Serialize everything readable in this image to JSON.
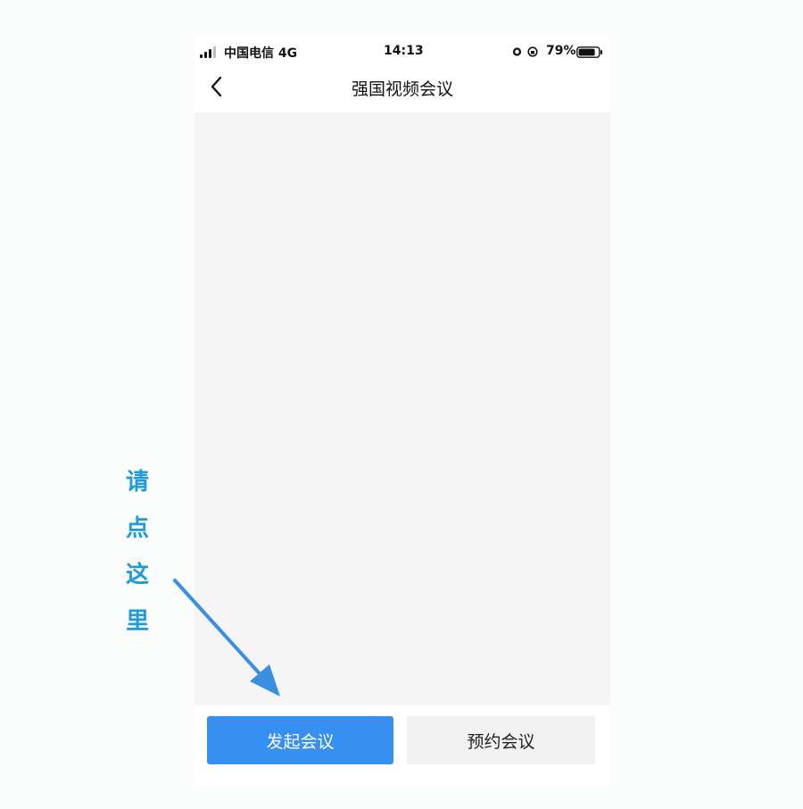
{
  "status_bar": {
    "carrier": "中国电信 4G",
    "time": "14:13",
    "battery": "79%",
    "icons": [
      "signal-icon",
      "alarm-icon",
      "rotation-lock-icon",
      "battery-icon"
    ]
  },
  "nav": {
    "title": "强国视频会议",
    "back_icon": "chevron-left-icon"
  },
  "buttons": {
    "start_meeting": "发起会议",
    "schedule_meeting": "预约会议"
  },
  "annotation": {
    "chars": [
      "请",
      "点",
      "这",
      "里"
    ],
    "color": "#1f9bd8",
    "arrow_color": "#3a8fe0"
  },
  "colors": {
    "primary_button": "#3790ef",
    "secondary_button": "#f2f2f2",
    "content_bg": "#f5f5f5"
  }
}
